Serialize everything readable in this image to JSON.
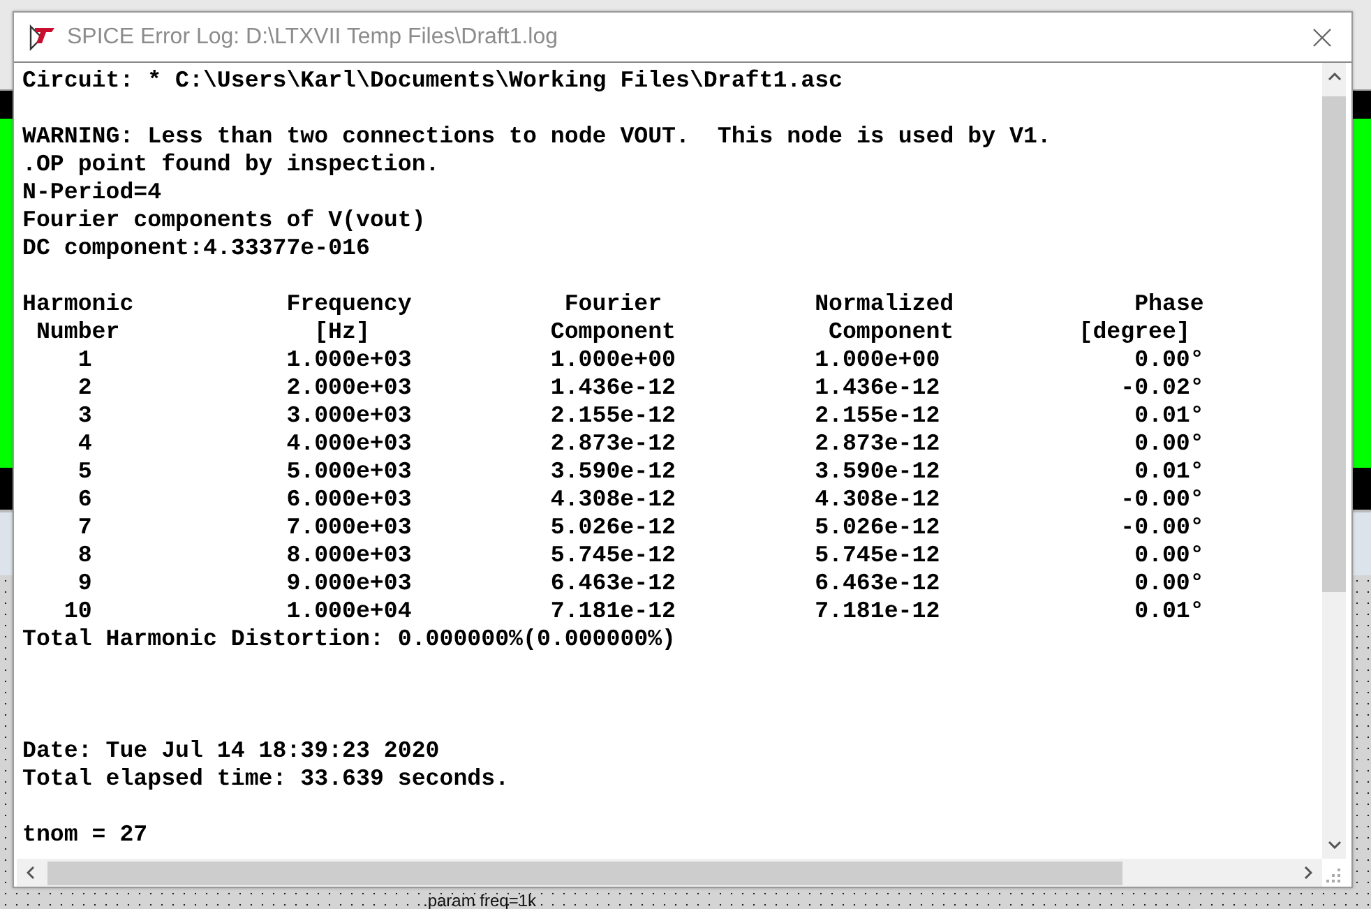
{
  "background": {
    "schematic_label": ".param freq=1k"
  },
  "window": {
    "title": "SPICE Error Log: D:\\LTXVII Temp Files\\Draft1.log"
  },
  "log": {
    "intro": [
      {
        "text": "Circuit: * C:\\Users\\Karl\\Documents\\Working Files\\Draft1.asc",
        "kind": "line"
      },
      {
        "text": "WARNING: Less than two connections to node VOUT.  This node is used by V1.",
        "kind": "gap"
      },
      {
        "text": ".OP point found by inspection.",
        "kind": "line"
      },
      {
        "text": "N-Period=4",
        "kind": "line"
      },
      {
        "text": "Fourier components of V(vout)",
        "kind": "line"
      },
      {
        "text": "DC component:4.33377e-016",
        "kind": "line"
      }
    ],
    "table": {
      "columns": [
        {
          "heading": "Harmonic",
          "subheading": "Number"
        },
        {
          "heading": "Frequency",
          "subheading": "[Hz]"
        },
        {
          "heading": "Fourier",
          "subheading": "Component"
        },
        {
          "heading": "Normalized",
          "subheading": "Component"
        },
        {
          "heading": "Phase",
          "subheading": "[degree]"
        }
      ],
      "rows": [
        [
          "1",
          "1.000e+03",
          "1.000e+00",
          "1.000e+00",
          "0.00°"
        ],
        [
          "2",
          "2.000e+03",
          "1.436e-12",
          "1.436e-12",
          "-0.02°"
        ],
        [
          "3",
          "3.000e+03",
          "2.155e-12",
          "2.155e-12",
          "0.01°"
        ],
        [
          "4",
          "4.000e+03",
          "2.873e-12",
          "2.873e-12",
          "0.00°"
        ],
        [
          "5",
          "5.000e+03",
          "3.590e-12",
          "3.590e-12",
          "0.01°"
        ],
        [
          "6",
          "6.000e+03",
          "4.308e-12",
          "4.308e-12",
          "-0.00°"
        ],
        [
          "7",
          "7.000e+03",
          "5.026e-12",
          "5.026e-12",
          "-0.00°"
        ],
        [
          "8",
          "8.000e+03",
          "5.745e-12",
          "5.745e-12",
          "0.00°"
        ],
        [
          "9",
          "9.000e+03",
          "6.463e-12",
          "6.463e-12",
          "0.00°"
        ],
        [
          "10",
          "1.000e+04",
          "7.181e-12",
          "7.181e-12",
          "0.01°"
        ]
      ]
    },
    "outro": [
      {
        "text": "Total Harmonic Distortion: 0.000000%(0.000000%)",
        "kind": "line"
      },
      {
        "text": "Date: Tue Jul 14 18:39:23 2020",
        "kind": "widegap"
      },
      {
        "text": "Total elapsed time: 33.639 seconds.",
        "kind": "line"
      },
      {
        "text": "tnom = 27",
        "kind": "gap"
      }
    ]
  }
}
